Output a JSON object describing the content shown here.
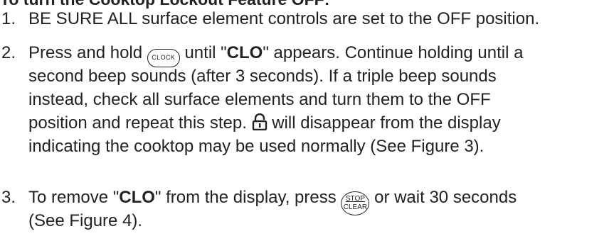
{
  "heading": "To turn the Cooktop Lockout Feature OFF:",
  "steps": [
    {
      "number": "1.",
      "lines": [
        "BE SURE ALL surface element controls are set to the OFF position."
      ]
    },
    {
      "number": "2.",
      "l1_a": "Press and hold",
      "clock_icon_label": "CLOCK",
      "l1_b": "until \"",
      "l1_bold": "CLO",
      "l1_c": "\" appears. Continue holding until a",
      "l2": "second beep sounds (after 3 seconds). If a triple beep sounds",
      "l3": "instead, check all surface elements and turn them to the OFF",
      "l4_a": "position and repeat this step.",
      "l4_b": "will disappear from the display",
      "l5": "indicating the cooktop may be used normally (See Figure 3)."
    },
    {
      "number": "3.",
      "l1_a": "To remove \"",
      "l1_bold": "CLO",
      "l1_b": "\" from the display, press",
      "stop_icon_top": "STOP",
      "stop_icon_bottom": "CLEAR",
      "l1_c": "or wait 30 seconds",
      "l2": "(See Figure 4)."
    }
  ]
}
